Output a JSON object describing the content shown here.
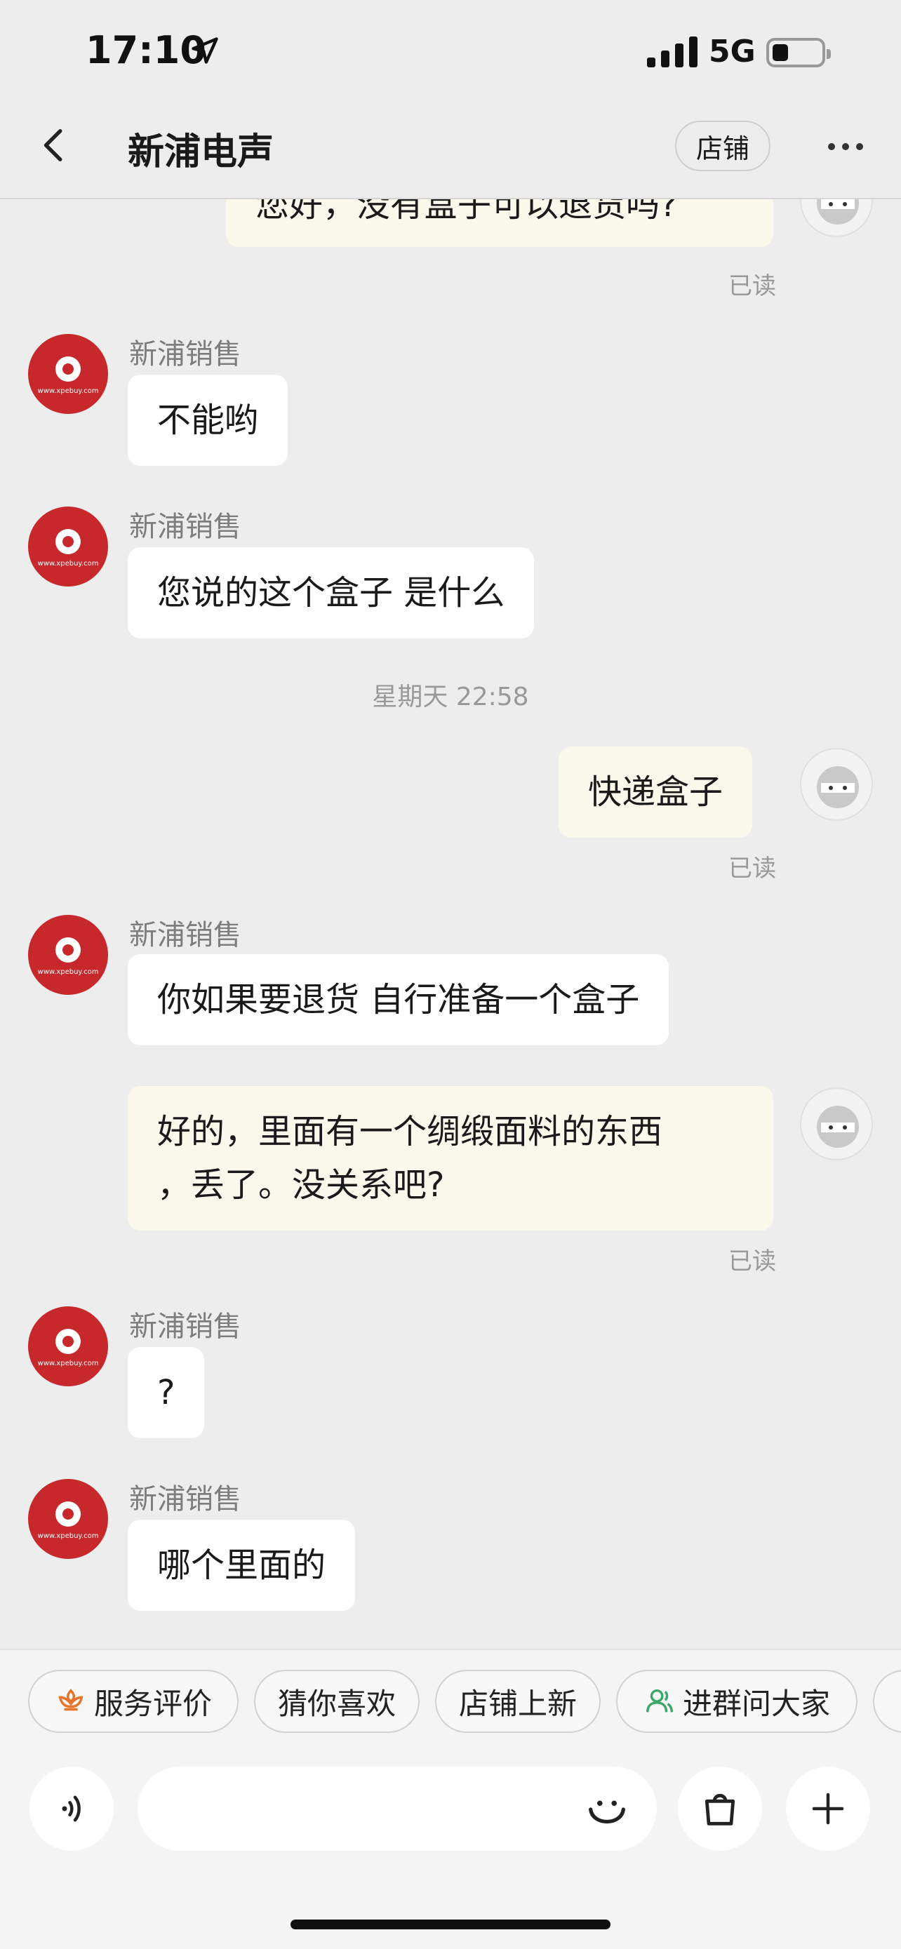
{
  "status_bar": {
    "time": "17:10",
    "network": "5G"
  },
  "header": {
    "title": "新浦电声",
    "shop_button": "店铺"
  },
  "messages": [
    {
      "sender": "",
      "text": "您好，没有盒子可以退货吗?",
      "read": "已读"
    },
    {
      "sender": "新浦销售",
      "text": "不能哟"
    },
    {
      "sender": "新浦销售",
      "text": "您说的这个盒子 是什么"
    },
    {
      "timestamp": "星期天 22:58"
    },
    {
      "sender": "",
      "text": "快递盒子",
      "read": "已读"
    },
    {
      "sender": "新浦销售",
      "text": "你如果要退货 自行准备一个盒子"
    },
    {
      "sender": "",
      "text_line1": "好的，里面有一个绸缎面料的东西",
      "text_line2": "，丢了。没关系吧?",
      "read": "已读"
    },
    {
      "sender": "新浦销售",
      "text": "?"
    },
    {
      "sender": "新浦销售",
      "text": "哪个里面的"
    }
  ],
  "quick_actions": [
    "服务评价",
    "猜你喜欢",
    "店铺上新",
    "进群问大家"
  ],
  "shop_avatar_text": "www.xpebuy.com",
  "colors": {
    "shop_avatar": "#c7282b",
    "incoming_bubble": "#ffffff",
    "outgoing_bubble": "#faf7eb",
    "background": "#ededed",
    "review_icon": "#e8742b",
    "group_icon": "#3aa86a"
  },
  "icons": [
    "back-icon",
    "more-icon",
    "location-arrow-icon",
    "voice-icon",
    "emoji-icon",
    "shopping-bag-icon",
    "plus-icon",
    "flower-icon",
    "people-icon"
  ]
}
